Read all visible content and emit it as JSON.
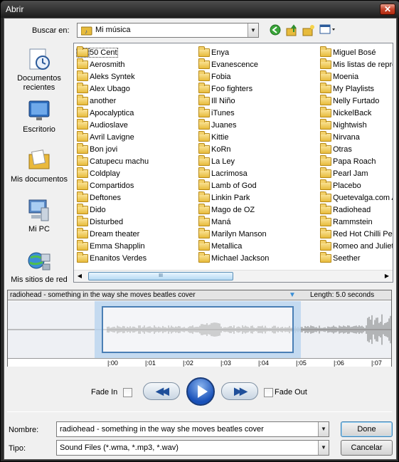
{
  "window": {
    "title": "Abrir",
    "close_label": "✕"
  },
  "lookin": {
    "label": "Buscar en:",
    "value": "Mi música"
  },
  "places": [
    {
      "label": "Documentos recientes",
      "icon": "recent-documents-icon",
      "color": "#4a7fc0"
    },
    {
      "label": "Escritorio",
      "icon": "desktop-icon",
      "color": "#2f6fbf"
    },
    {
      "label": "Mis documentos",
      "icon": "my-documents-icon",
      "color": "#e9b93c"
    },
    {
      "label": "Mi PC",
      "icon": "my-computer-icon",
      "color": "#5b8ac6"
    },
    {
      "label": "Mis sitios de red",
      "icon": "network-icon",
      "color": "#3c8f4a"
    }
  ],
  "files": {
    "col1": [
      "50 Cent",
      "Aerosmith",
      "Aleks Syntek",
      "Alex Ubago",
      "another",
      "Apocalyptica",
      "Audioslave",
      "Avril Lavigne",
      "Bon jovi",
      "Catupecu machu",
      "Coldplay",
      "Compartidos",
      "Deftones",
      "Dido",
      "Disturbed",
      "Dream theater",
      "Emma Shapplin",
      "Enanitos Verdes"
    ],
    "col2": [
      "Enya",
      "Evanescence",
      "Fobia",
      "Foo fighters",
      "Ill Niño",
      "iTunes",
      "Juanes",
      "Kittie",
      "KoRn",
      "La Ley",
      "Lacrimosa",
      "Lamb of God",
      "Linkin Park",
      "Mago de OZ",
      "Maná",
      "Marilyn Manson",
      "Metallica",
      "Michael Jackson"
    ],
    "col3": [
      "Miguel Bosé",
      "Mis listas de repro",
      "Moenia",
      "My Playlists",
      "Nelly Furtado",
      "NickelBack",
      "Nightwish",
      "Nirvana",
      "Otras",
      "Papa Roach",
      "Pearl Jam",
      "Placebo",
      "Quetevalga.com A",
      "Radiohead",
      "Rammstein",
      "Red Hot Chilli Pepp",
      "Romeo and Juliet",
      "Seether"
    ]
  },
  "scrollbar": {
    "thumb_grip": "III"
  },
  "wave": {
    "title": "radiohead - something in the way she moves beatles cover",
    "length": "Length: 5.0 seconds",
    "ticks": [
      "|:00",
      "|:01",
      "|:02",
      "|:03",
      "|:04",
      "|:05",
      "|:06",
      "|:07"
    ]
  },
  "transport": {
    "fade_in": "Fade In",
    "fade_out": "Fade Out",
    "rewind": "◀◀",
    "forward": "▶▶"
  },
  "filename": {
    "label": "Nombre:",
    "value": "radiohead - something in the way she moves beatles cover"
  },
  "filetype": {
    "label": "Tipo:",
    "value": "Sound Files (*.wma, *.mp3, *.wav)"
  },
  "buttons": {
    "ok": "Done",
    "cancel": "Cancelar"
  }
}
